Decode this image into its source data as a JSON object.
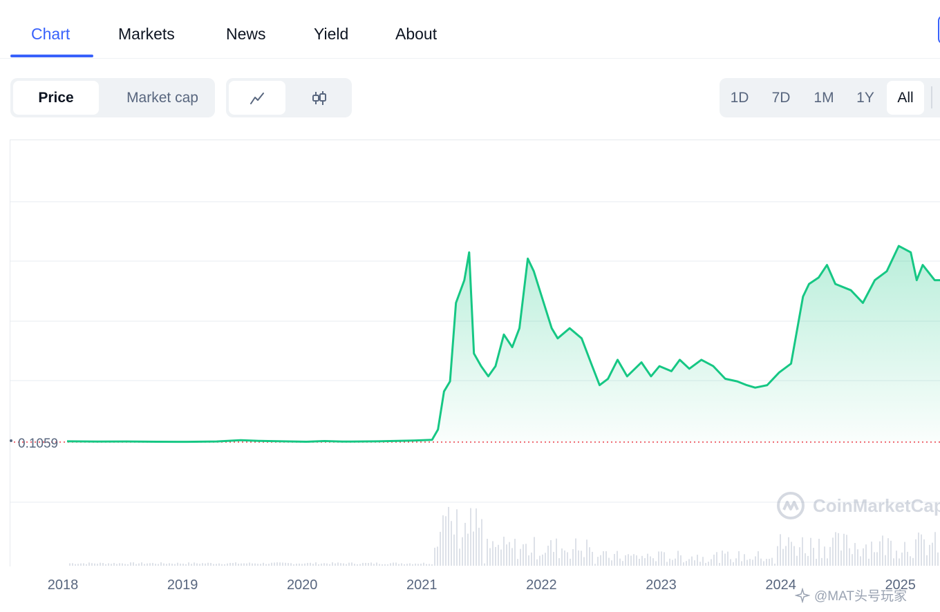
{
  "tabs": [
    {
      "label": "Chart",
      "active": true
    },
    {
      "label": "Markets"
    },
    {
      "label": "News"
    },
    {
      "label": "Yield"
    },
    {
      "label": "About"
    }
  ],
  "metric_toggle": {
    "price_label": "Price",
    "market_cap_label": "Market cap",
    "selected": "Price"
  },
  "chart_type_toggle": {
    "line_icon": "line-chart-icon",
    "candle_icon": "candlestick-icon",
    "selected": "line"
  },
  "range_toggle": {
    "options": [
      "1D",
      "7D",
      "1M",
      "1Y",
      "All"
    ],
    "selected": "All"
  },
  "current_price_label": "0.1059",
  "watermark": "CoinMarketCap",
  "credit": "@MAT头号玩家",
  "colors": {
    "accent": "#3861fb",
    "line": "#16c784",
    "muted": "#58667e",
    "baseline": "#ea3943"
  },
  "chart_data": {
    "type": "area",
    "x_ticks": [
      "2018",
      "2019",
      "2020",
      "2021",
      "2022",
      "2023",
      "2024",
      "2025"
    ],
    "baseline_value_label": "0.1059",
    "series": [
      {
        "values": [
          [
            2018.0,
            0.106
          ],
          [
            2018.25,
            0.104
          ],
          [
            2018.5,
            0.105
          ],
          [
            2018.75,
            0.103
          ],
          [
            2019.0,
            0.102
          ],
          [
            2019.25,
            0.105
          ],
          [
            2019.45,
            0.115
          ],
          [
            2019.6,
            0.11
          ],
          [
            2019.8,
            0.106
          ],
          [
            2020.0,
            0.103
          ],
          [
            2020.15,
            0.108
          ],
          [
            2020.3,
            0.104
          ],
          [
            2020.6,
            0.106
          ],
          [
            2020.9,
            0.112
          ],
          [
            2021.05,
            0.118
          ],
          [
            2021.1,
            0.2
          ],
          [
            2021.15,
            0.5
          ],
          [
            2021.2,
            0.58
          ],
          [
            2021.25,
            1.2
          ],
          [
            2021.32,
            1.38
          ],
          [
            2021.36,
            1.6
          ],
          [
            2021.4,
            0.8
          ],
          [
            2021.46,
            0.7
          ],
          [
            2021.52,
            0.62
          ],
          [
            2021.58,
            0.7
          ],
          [
            2021.65,
            0.95
          ],
          [
            2021.72,
            0.85
          ],
          [
            2021.78,
            1.0
          ],
          [
            2021.85,
            1.55
          ],
          [
            2021.9,
            1.45
          ],
          [
            2021.95,
            1.3
          ],
          [
            2022.05,
            1.0
          ],
          [
            2022.1,
            0.92
          ],
          [
            2022.2,
            1.0
          ],
          [
            2022.3,
            0.92
          ],
          [
            2022.38,
            0.72
          ],
          [
            2022.45,
            0.55
          ],
          [
            2022.52,
            0.6
          ],
          [
            2022.6,
            0.75
          ],
          [
            2022.68,
            0.62
          ],
          [
            2022.8,
            0.73
          ],
          [
            2022.88,
            0.62
          ],
          [
            2022.95,
            0.7
          ],
          [
            2023.05,
            0.66
          ],
          [
            2023.12,
            0.75
          ],
          [
            2023.2,
            0.68
          ],
          [
            2023.3,
            0.75
          ],
          [
            2023.4,
            0.7
          ],
          [
            2023.5,
            0.6
          ],
          [
            2023.6,
            0.58
          ],
          [
            2023.68,
            0.55
          ],
          [
            2023.75,
            0.53
          ],
          [
            2023.85,
            0.55
          ],
          [
            2023.95,
            0.65
          ],
          [
            2024.05,
            0.72
          ],
          [
            2024.15,
            1.25
          ],
          [
            2024.2,
            1.35
          ],
          [
            2024.28,
            1.4
          ],
          [
            2024.35,
            1.5
          ],
          [
            2024.42,
            1.35
          ],
          [
            2024.55,
            1.3
          ],
          [
            2024.65,
            1.2
          ],
          [
            2024.75,
            1.38
          ],
          [
            2024.85,
            1.45
          ],
          [
            2024.95,
            1.65
          ],
          [
            2025.05,
            1.6
          ],
          [
            2025.1,
            1.38
          ],
          [
            2025.15,
            1.5
          ],
          [
            2025.25,
            1.38
          ]
        ]
      }
    ]
  }
}
